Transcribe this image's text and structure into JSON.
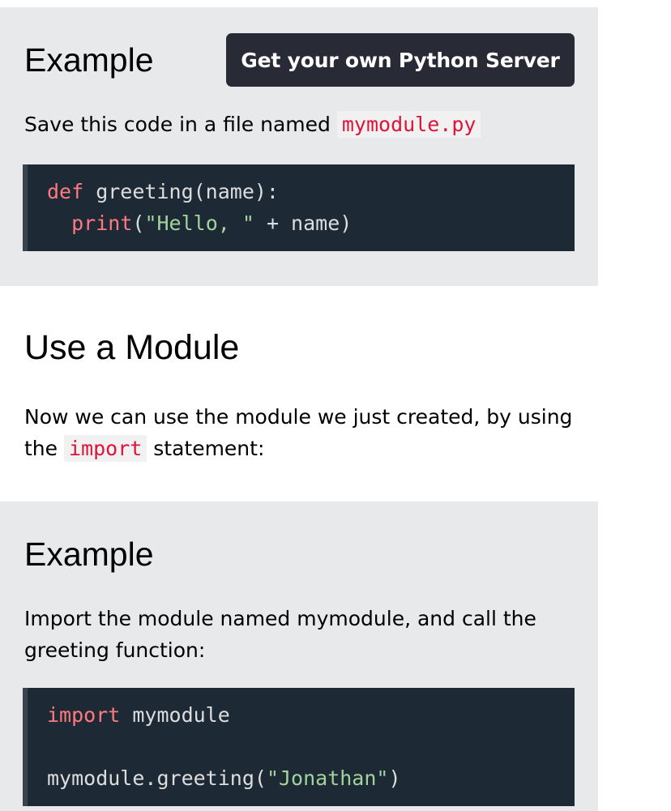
{
  "example1": {
    "heading": "Example",
    "button_label": "Get your own Python Server",
    "text_before": "Save this code in a file named ",
    "filename": "mymodule.py",
    "code": {
      "line1_kw": "def",
      "line1_rest": " greeting(name):",
      "line2_indent": "  ",
      "line2_fn": "print",
      "line2_open": "(",
      "line2_str": "\"Hello, \"",
      "line2_rest": " + name)"
    }
  },
  "section": {
    "heading": "Use a Module",
    "text_before": "Now we can use the module we just created, by using the ",
    "keyword": "import",
    "text_after": " statement:"
  },
  "example2": {
    "heading": "Example",
    "description": "Import the module named mymodule, and call the greeting function:",
    "code": {
      "line1_kw": "import",
      "line1_rest": " mymodule",
      "line3_call": "mymodule.greeting(",
      "line3_str": "\"Jonathan\"",
      "line3_close": ")"
    }
  },
  "colors": {
    "example_bg": "#e7e9eb",
    "code_bg": "#1d2a35",
    "inline_code": "#dc143c",
    "button_bg": "#282a35"
  }
}
